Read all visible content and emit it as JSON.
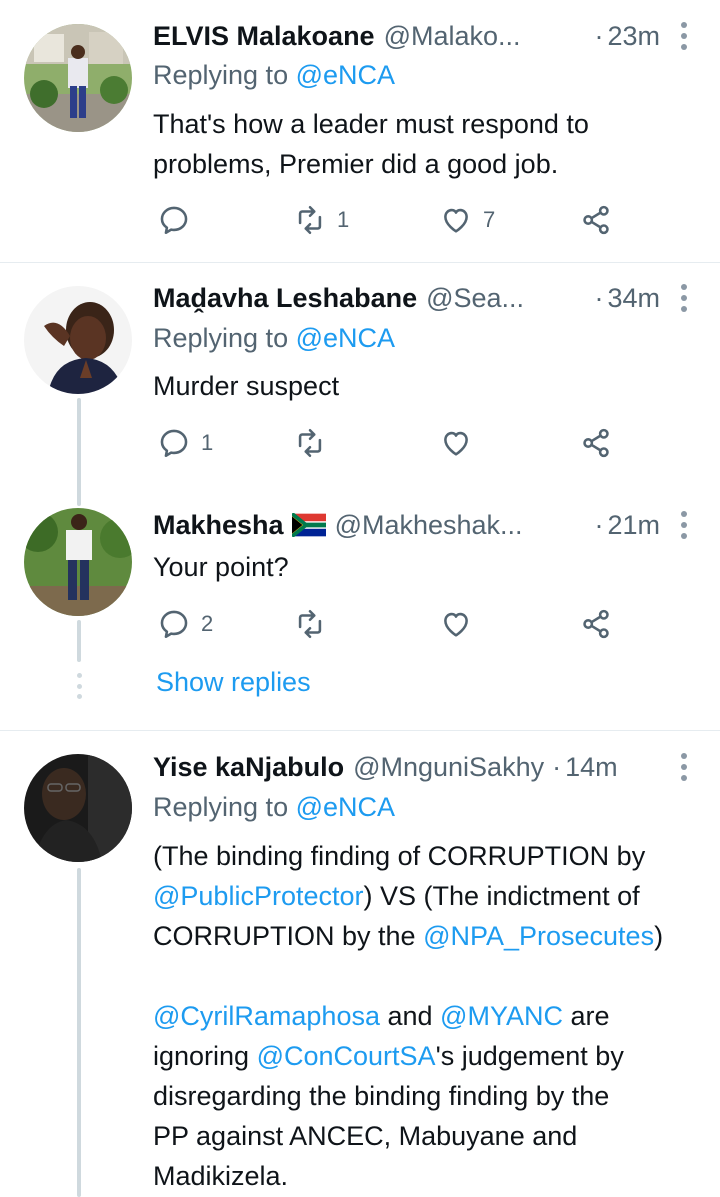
{
  "tweets": [
    {
      "name": "ELVIS Malakoane",
      "handle": "@Malako...",
      "time": "23m",
      "replying_prefix": "Replying to ",
      "replying_to": "@eNCA",
      "text_lines": [
        "That's how a leader must respond to",
        "problems, Premier did a good job."
      ],
      "reply_count": "",
      "retweet_count": "1",
      "like_count": "7"
    },
    {
      "name": "Maḓavha Leshabane",
      "handle": "@Sea...",
      "time": "34m",
      "replying_prefix": "Replying to ",
      "replying_to": "@eNCA",
      "text_lines": [
        "Murder suspect"
      ],
      "reply_count": "1",
      "retweet_count": "",
      "like_count": ""
    },
    {
      "name": "Makhesha",
      "handle": "@Makheshak...",
      "time": "21m",
      "text_lines": [
        "Your point?"
      ],
      "reply_count": "2",
      "retweet_count": "",
      "like_count": ""
    },
    {
      "name": "Yise kaNjabulo",
      "handle": "@MnguniSakhy",
      "time": "14m",
      "replying_prefix": "Replying to ",
      "replying_to": "@eNCA",
      "para1": {
        "l1": "(The binding finding of CORRUPTION by",
        "l2_link": "@PublicProtector",
        "l2_rest": ") VS (The indictment of",
        "l3_pre": "CORRUPTION by the ",
        "l3_link": "@NPA_Prosecutes",
        "l3_post": ")"
      },
      "para2": {
        "l1_link1": "@CyrilRamaphosa",
        "l1_mid": " and ",
        "l1_link2": "@MYANC",
        "l1_post": " are",
        "l2_pre": "ignoring ",
        "l2_link": "@ConCourtSA",
        "l2_post": "'s judgement by",
        "l3": "disregarding the binding finding by the",
        "l4": "PP against ANCEC, Mabuyane and",
        "l5": "Madikizela."
      }
    }
  ],
  "show_replies": "Show replies",
  "time_separator": "·",
  "icons": {
    "reply": "reply-icon",
    "retweet": "retweet-icon",
    "like": "heart-icon",
    "share": "share-icon",
    "more": "more-icon",
    "flag": "south-africa-flag-icon"
  },
  "colors": {
    "link": "#1d9bf0",
    "secondary": "#536471",
    "text": "#0f1419",
    "line": "#cfd9de"
  }
}
